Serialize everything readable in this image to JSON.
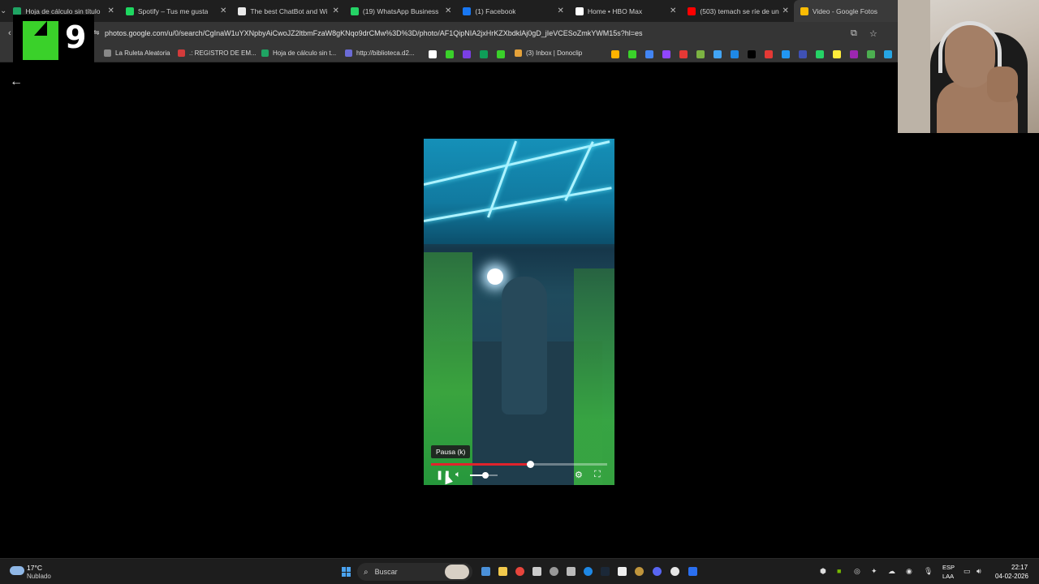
{
  "browser": {
    "tabs": [
      {
        "title": "Hoja de cálculo sin título",
        "color": "#1fa463"
      },
      {
        "title": "Spotify – Tus me gusta",
        "color": "#1ed760"
      },
      {
        "title": "The best ChatBot and Wi",
        "color": "#e9e9e9"
      },
      {
        "title": "(19) WhatsApp Business",
        "color": "#25d366"
      },
      {
        "title": "(1) Facebook",
        "color": "#1877f2"
      },
      {
        "title": "Home • HBO Max",
        "color": "#ffffff"
      },
      {
        "title": "(503) temach se ríe de un",
        "color": "#ff0000"
      },
      {
        "title": "Video - Google Fotos",
        "color": "#fbbc04"
      }
    ],
    "url": "photos.google.com/u/0/search/CgInaW1uYXNpbyAiCwoJZ2ltbmFzaW8gKNqo9drCMw%3D%3D/photo/AF1QipNIA2jxHrKZXbdklAj0gD_jIeVCESoZmkYWM15s?hl=es",
    "bookmarks": [
      {
        "label": "La Ruleta Aleatoria",
        "color": "#888888"
      },
      {
        "label": ".: REGISTRO DE EM...",
        "color": "#d33b3b"
      },
      {
        "label": "Hoja de cálculo sin t...",
        "color": "#1fa463"
      },
      {
        "label": "http://biblioteca.d2...",
        "color": "#6b6bd6"
      },
      {
        "label": "(3) Inbox | Donoclip",
        "color": "#e5a23a"
      }
    ]
  },
  "logo": {
    "number": "9"
  },
  "page": {
    "back_icon": "arrow-left-icon",
    "tooltip": "Pausa (k)",
    "progress_fraction": 0.56,
    "volume_fraction": 0.55
  },
  "taskbar": {
    "temperature": "17°C",
    "condition": "Nublado",
    "search_placeholder": "Buscar",
    "lang_top": "ESP",
    "lang_bottom": "LAA",
    "time": "22:17",
    "date": "04-02-2026"
  }
}
